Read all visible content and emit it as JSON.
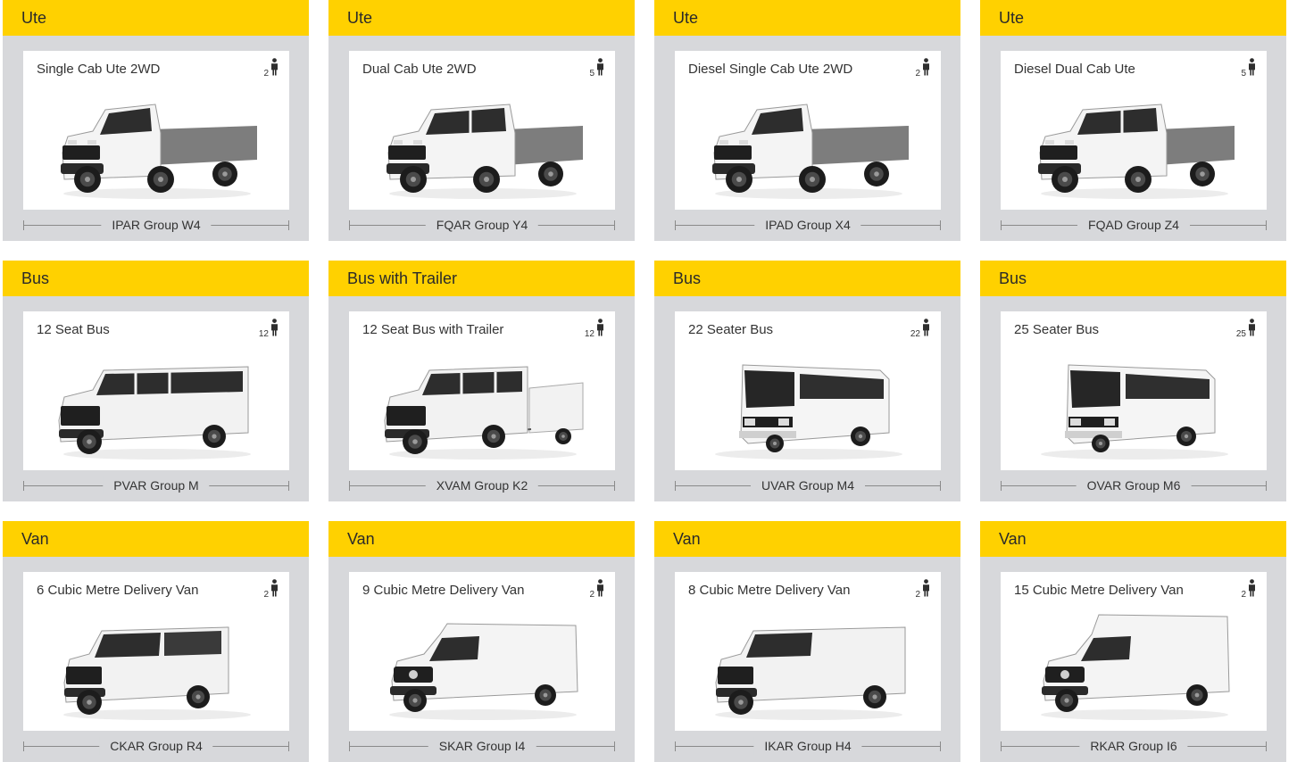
{
  "vehicles": [
    {
      "category": "Ute",
      "name": "Single Cab Ute 2WD",
      "seats": "2",
      "group": "IPAR Group W4",
      "kind": "single-cab-ute"
    },
    {
      "category": "Ute",
      "name": "Dual Cab Ute 2WD",
      "seats": "5",
      "group": "FQAR Group Y4",
      "kind": "dual-cab-ute"
    },
    {
      "category": "Ute",
      "name": "Diesel Single Cab Ute 2WD",
      "seats": "2",
      "group": "IPAD Group X4",
      "kind": "single-cab-ute"
    },
    {
      "category": "Ute",
      "name": "Diesel Dual Cab Ute",
      "seats": "5",
      "group": "FQAD Group Z4",
      "kind": "dual-cab-ute"
    },
    {
      "category": "Bus",
      "name": "12 Seat Bus",
      "seats": "12",
      "group": "PVAR Group M",
      "kind": "minibus"
    },
    {
      "category": "Bus with Trailer",
      "name": "12 Seat Bus with Trailer",
      "seats": "12",
      "group": "XVAM Group K2",
      "kind": "minibus-trailer"
    },
    {
      "category": "Bus",
      "name": "22 Seater Bus",
      "seats": "22",
      "group": "UVAR Group M4",
      "kind": "coach"
    },
    {
      "category": "Bus",
      "name": "25 Seater Bus",
      "seats": "25",
      "group": "OVAR Group M6",
      "kind": "coach"
    },
    {
      "category": "Van",
      "name": "6 Cubic Metre Delivery Van",
      "seats": "2",
      "group": "CKAR Group R4",
      "kind": "van"
    },
    {
      "category": "Van",
      "name": "9 Cubic Metre Delivery Van",
      "seats": "2",
      "group": "SKAR Group I4",
      "kind": "sprinter"
    },
    {
      "category": "Van",
      "name": "8 Cubic Metre Delivery Van",
      "seats": "2",
      "group": "IKAR Group H4",
      "kind": "van-long"
    },
    {
      "category": "Van",
      "name": "15 Cubic Metre Delivery Van",
      "seats": "2",
      "group": "RKAR Group I6",
      "kind": "sprinter-high"
    }
  ],
  "colors": {
    "header": "#ffd100",
    "card": "#d7d8db",
    "panel": "#ffffff",
    "text": "#333333"
  },
  "icons": {
    "seats": "person-icon",
    "vehicle": "vehicle-image"
  }
}
